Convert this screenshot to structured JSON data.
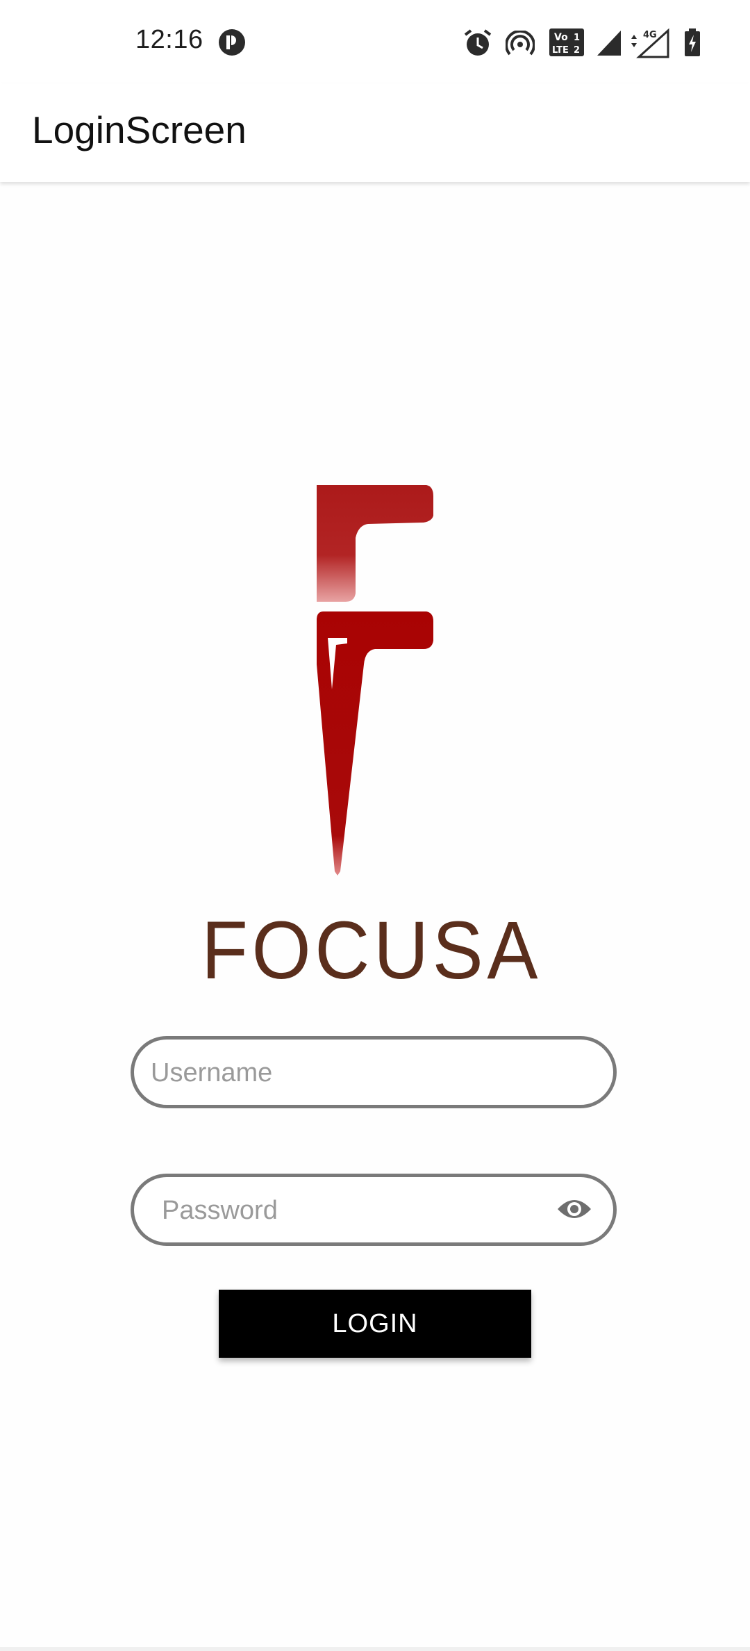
{
  "status_bar": {
    "time": "12:16",
    "icons": [
      "app-notification-icon",
      "alarm-icon",
      "hotspot-icon",
      "volte-icon",
      "signal-icon",
      "signal-4g-icon",
      "battery-charging-icon"
    ],
    "volte_label": "Vo LTE",
    "network_label": "4G"
  },
  "app_bar": {
    "title": "LoginScreen"
  },
  "logo": {
    "brand_name": "FOCUSA",
    "brand_color": "#a30e0e",
    "text_color": "#5a2e1c"
  },
  "form": {
    "username": {
      "value": "",
      "placeholder": "Username"
    },
    "password": {
      "value": "",
      "placeholder": "Password",
      "toggle_icon": "eye-icon"
    },
    "login_label": "LOGIN"
  },
  "colors": {
    "button_bg": "#000000",
    "button_text": "#ffffff",
    "field_border": "#7a7a7a",
    "placeholder": "#9a9a9a"
  }
}
